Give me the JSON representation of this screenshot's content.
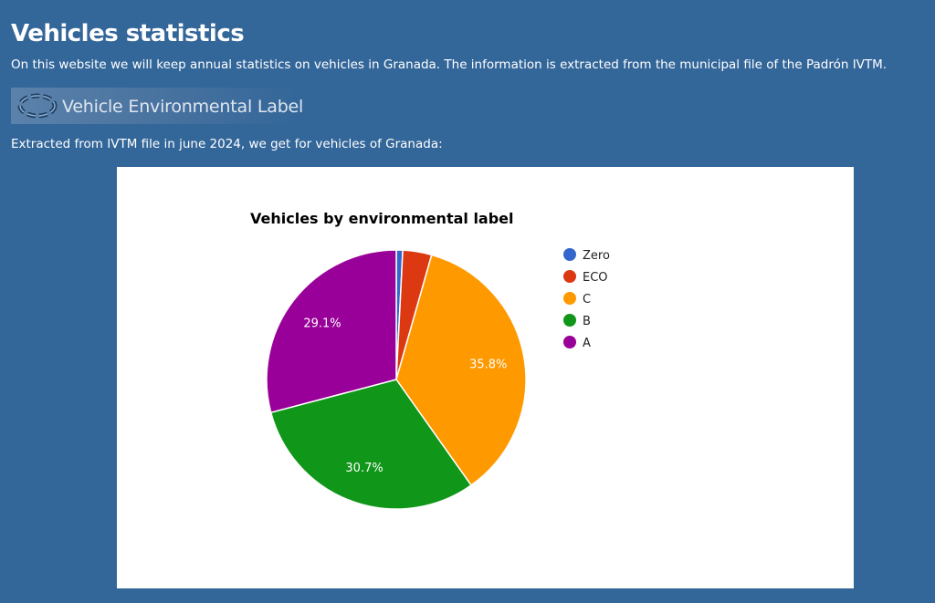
{
  "header": {
    "title": "Vehicles statistics",
    "intro": "On this website we will keep annual statistics on vehicles in Granada. The information is extracted from the municipal file of the Padrón IVTM."
  },
  "banner": {
    "label": "Vehicle Environmental Label"
  },
  "extracted_text": "Extracted from IVTM file in june 2024, we get for vehicles of Granada:",
  "chart_data": {
    "type": "pie",
    "title": "Vehicles by environmental label",
    "legend_position": "right",
    "slices": [
      {
        "name": "Zero",
        "value": 0.8,
        "color": "#3366cc",
        "label": ""
      },
      {
        "name": "ECO",
        "value": 3.6,
        "color": "#dc3912",
        "label": ""
      },
      {
        "name": "C",
        "value": 35.8,
        "color": "#ff9900",
        "label": "35.8%"
      },
      {
        "name": "B",
        "value": 30.7,
        "color": "#109618",
        "label": "30.7%"
      },
      {
        "name": "A",
        "value": 29.1,
        "color": "#990099",
        "label": "29.1%"
      }
    ]
  }
}
